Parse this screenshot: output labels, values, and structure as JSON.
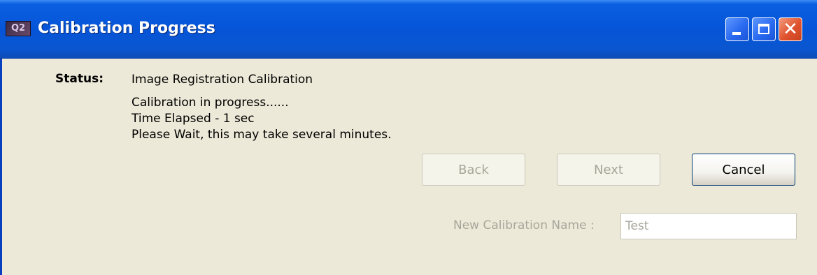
{
  "window": {
    "title": "Calibration Progress",
    "app_icon_text": "Q2"
  },
  "status": {
    "label": "Status:",
    "lines": [
      "Image Registration Calibration",
      "Calibration in progress......",
      "Time Elapsed - 1 sec",
      "Please Wait, this may take several minutes."
    ]
  },
  "buttons": {
    "back": "Back",
    "next": "Next",
    "cancel": "Cancel"
  },
  "calibration_name": {
    "label": "New Calibration Name :",
    "value": "Test"
  },
  "colors": {
    "titlebar": "#0655D8",
    "dialog_background": "#ECE9D8",
    "disabled_text": "#A7A69A"
  }
}
